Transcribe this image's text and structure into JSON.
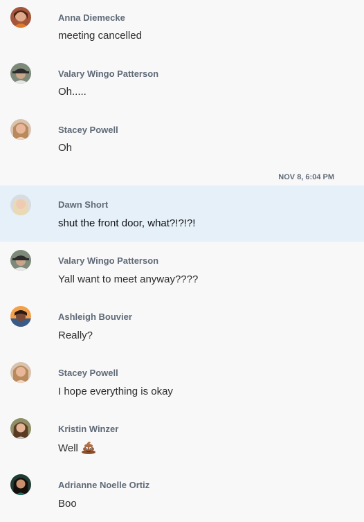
{
  "timestamp": "NOV 8, 6:04 PM",
  "messages": [
    {
      "sender": "Anna Diemecke",
      "text": "meeting cancelled",
      "avatar": "woman-red-hair-avatar"
    },
    {
      "sender": "Valary Wingo Patterson",
      "text": "Oh.....",
      "avatar": "woman-hat-avatar"
    },
    {
      "sender": "Stacey Powell",
      "text": "Oh",
      "avatar": "woman-blonde-avatar"
    },
    {
      "sender": "Dawn Short",
      "text": "shut the front door, what?!?!?!",
      "avatar": "woman-light-blonde-avatar"
    },
    {
      "sender": "Valary Wingo Patterson",
      "text": "Yall want to meet anyway????",
      "avatar": "woman-hat-avatar"
    },
    {
      "sender": "Ashleigh Bouvier",
      "text": "Really?",
      "avatar": "woman-sunset-avatar"
    },
    {
      "sender": "Stacey Powell",
      "text": "I hope everything is okay",
      "avatar": "woman-blonde-avatar"
    },
    {
      "sender": "Kristin Winzer",
      "text": "Well",
      "avatar": "woman-brown-hair-avatar",
      "emoji": "pile-of-poo-emoji"
    },
    {
      "sender": "Adrianne Noelle Ortiz",
      "text": "Boo",
      "avatar": "woman-dark-hair-avatar"
    }
  ]
}
